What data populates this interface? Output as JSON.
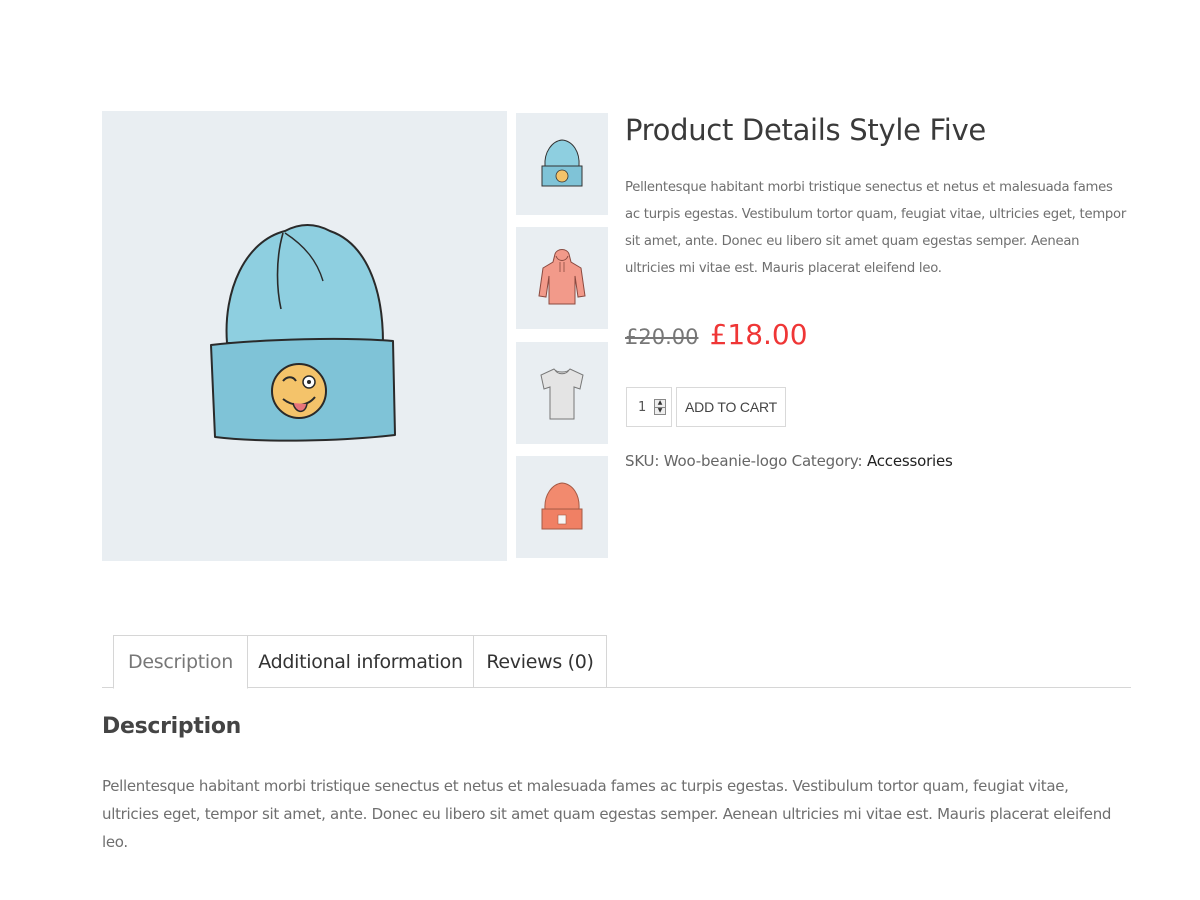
{
  "product": {
    "title": "Product Details Style Five",
    "short_description": "Pellentesque habitant morbi tristique senectus et netus et malesuada fames ac turpis egestas. Vestibulum tortor quam, feugiat vitae, ultricies eget, tempor sit amet, ante. Donec eu libero sit amet quam egestas semper. Aenean ultricies mi vitae est. Mauris placerat eleifend leo.",
    "old_price": "£20.00",
    "price": "£18.00",
    "quantity": "1",
    "add_to_cart_label": "ADD TO CART",
    "sku_label": "SKU:",
    "sku": "Woo-beanie-logo",
    "category_label": "Category:",
    "category": "Accessories"
  },
  "gallery": {
    "main_image": "blue-beanie-with-emoji-patch",
    "thumbnails": [
      {
        "name": "blue-beanie-thumbnail"
      },
      {
        "name": "pink-hoodie-thumbnail"
      },
      {
        "name": "grey-tshirt-thumbnail"
      },
      {
        "name": "coral-beanie-thumbnail"
      }
    ]
  },
  "tabs": [
    {
      "label": "Description",
      "active": true
    },
    {
      "label": "Additional information",
      "active": false
    },
    {
      "label": "Reviews (0)",
      "active": false
    }
  ],
  "panel": {
    "heading": "Description",
    "text": "Pellentesque habitant morbi tristique senectus et netus et malesuada fames ac turpis egestas. Vestibulum tortor quam, feugiat vitae, ultricies eget, tempor sit amet, ante. Donec eu libero sit amet quam egestas semper. Aenean ultricies mi vitae est. Mauris placerat eleifend leo."
  },
  "colors": {
    "sale_price": "#ef3636",
    "image_background": "#e9eef2",
    "beanie_blue": "#8ecfe0",
    "hoodie_pink": "#f29a8a",
    "beanie_coral": "#f28a6e"
  }
}
